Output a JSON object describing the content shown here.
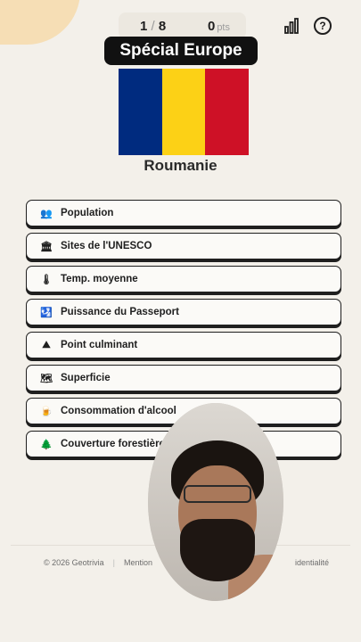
{
  "header": {
    "progress_current": "1",
    "progress_separator": "/",
    "progress_total": "8",
    "points": "0",
    "points_unit": "pts",
    "stats_icon": "bar-chart-icon",
    "help_icon": "question-circle-icon",
    "help_glyph": "?"
  },
  "mode_banner": "Spécial Europe",
  "flag": {
    "colors": [
      "#002B7F",
      "#FCD116",
      "#CE1126"
    ]
  },
  "country": "Roumanie",
  "categories": [
    {
      "label": "Population",
      "icon": "people-icon",
      "glyph": "👥"
    },
    {
      "label": "Sites de l'UNESCO",
      "icon": "monument-icon",
      "glyph": "🏛"
    },
    {
      "label": "Temp. moyenne",
      "icon": "thermometer-icon",
      "glyph": "🌡"
    },
    {
      "label": "Puissance du Passeport",
      "icon": "passport-icon",
      "glyph": "🛂"
    },
    {
      "label": "Point culminant",
      "icon": "mountain-icon",
      "glyph": "⛰"
    },
    {
      "label": "Superficie",
      "icon": "map-icon",
      "glyph": "🗺"
    },
    {
      "label": "Consommation d'alcool",
      "icon": "beer-icon",
      "glyph": "🍺"
    },
    {
      "label": "Couverture forestière",
      "icon": "tree-icon",
      "glyph": "🌲"
    }
  ],
  "footer": {
    "copyright": "© 2026 Geotrivia",
    "pipe": "|",
    "legal": "Mention",
    "privacy": "identialité"
  }
}
